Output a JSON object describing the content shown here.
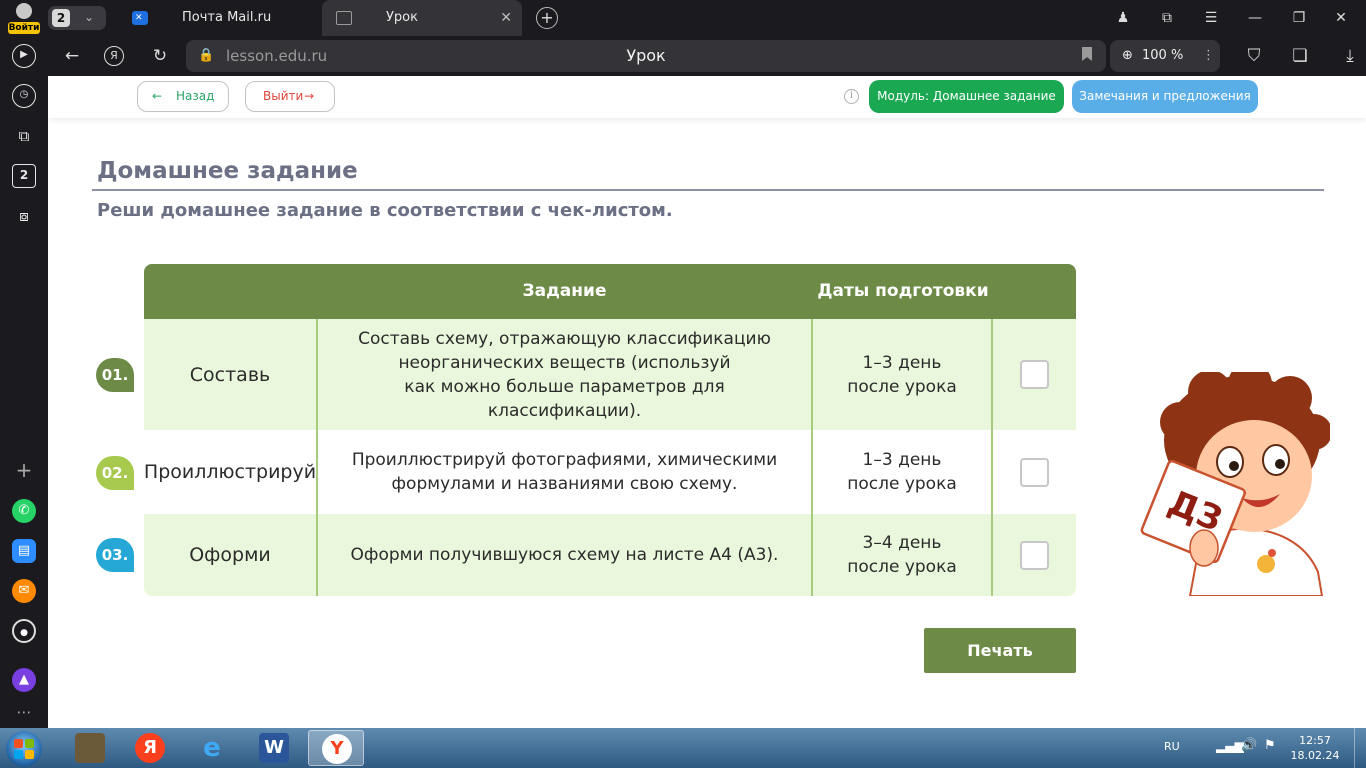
{
  "browser": {
    "login_label": "Войти",
    "tab_count": "2",
    "tabs": [
      {
        "title": "Почта Mail.ru",
        "icon": "mail-ru-icon",
        "color": "#1f6fe0"
      },
      {
        "title": "Урок",
        "icon": "page-icon"
      }
    ],
    "url_host": "lesson.edu.ru",
    "page_title": "Урок",
    "zoom": "100 %",
    "sidebar_badge": "2"
  },
  "page": {
    "nav": {
      "back_label": "Назад",
      "exit_label": "Выйти",
      "module_label": "Модуль: Домашнее задание",
      "notes_label": "Замечания и предложения"
    },
    "heading": "Домашнее задание",
    "subheading": "Реши домашнее задание в соответствии с чек-листом.",
    "table": {
      "headers": [
        "",
        "Задание",
        "Даты подготовки",
        ""
      ],
      "rows": [
        {
          "num": "01.",
          "action": "Составь",
          "task": [
            "Составь схему, отражающую классификацию",
            "неорганических веществ (используй",
            "как можно больше параметров для классификации)."
          ],
          "dates": [
            "1–3 день",
            "после урока"
          ],
          "checked": false
        },
        {
          "num": "02.",
          "action": "Проиллюстрируй",
          "task": [
            "Проиллюстрируй фотографиями, химическими",
            "формулами и названиями свою схему."
          ],
          "dates": [
            "1–3 день",
            "после урока"
          ],
          "checked": false
        },
        {
          "num": "03.",
          "action": "Оформи",
          "task": [
            "Оформи получившуюся схему на листе А4 (А3)."
          ],
          "dates": [
            "3–4 день",
            "после урока"
          ],
          "checked": false
        }
      ]
    },
    "print_label": "Печать",
    "mascot_sign": "ДЗ",
    "colors": {
      "header_green": "#6d8b47",
      "row_tint": "#e9f8dc",
      "module_green": "#1aa852",
      "notes_blue": "#5aaee8",
      "badge1": "#6d8b47",
      "badge2": "#a6c94e",
      "badge3": "#25a8d6"
    }
  },
  "taskbar": {
    "lang": "RU",
    "time": "12:57",
    "date": "18.02.24"
  }
}
